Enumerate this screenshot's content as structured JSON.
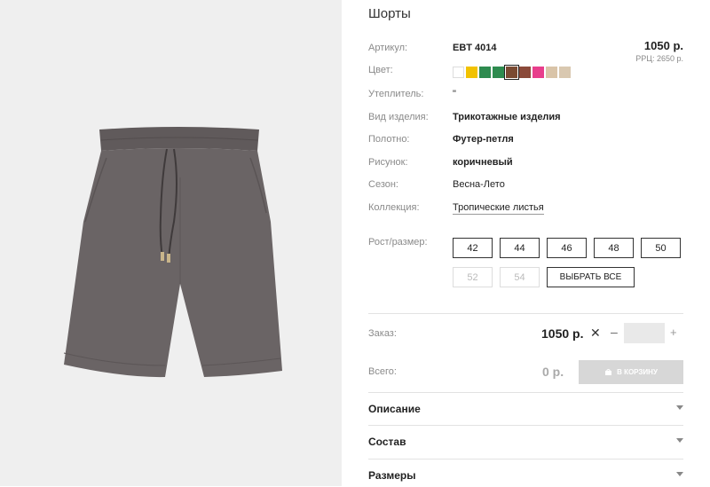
{
  "product": {
    "title": "Шорты",
    "price": "1050 р.",
    "rrp": "РРЦ: 2650 р."
  },
  "specs": [
    {
      "label": "Артикул:",
      "value": "EBT 4014"
    },
    {
      "label": "Цвет:",
      "value": ""
    },
    {
      "label": "Утеплитель:",
      "value": "\""
    },
    {
      "label": "Вид изделия:",
      "value": "Трикотажные изделия"
    },
    {
      "label": "Полотно:",
      "value": "Футер-петля"
    },
    {
      "label": "Рисунок:",
      "value": "коричневый"
    },
    {
      "label": "Сезон:",
      "value": "Весна-Лето"
    },
    {
      "label": "Коллекция:",
      "value": "Тропические листья"
    }
  ],
  "colors": [
    "#ffffff",
    "#f2c200",
    "#2e8b4f",
    "#2e8b4f",
    "#7a4a32",
    "#8b4a3a",
    "#e83e8c",
    "#d9c4a8",
    "#d9c8b0"
  ],
  "selected_color_index": 4,
  "size": {
    "label": "Рост/размер:",
    "options": [
      "42",
      "44",
      "46",
      "48",
      "50"
    ],
    "disabled": [
      "52",
      "54"
    ],
    "select_all": "ВЫБРАТЬ ВСЕ"
  },
  "order": {
    "label": "Заказ:",
    "price": "1050 р.",
    "times": "✕",
    "minus": "–",
    "plus": "+",
    "total_label": "Всего:",
    "total": "0 р.",
    "cart_button": "В КОРЗИНУ"
  },
  "accordion": [
    "Описание",
    "Состав",
    "Размеры"
  ]
}
